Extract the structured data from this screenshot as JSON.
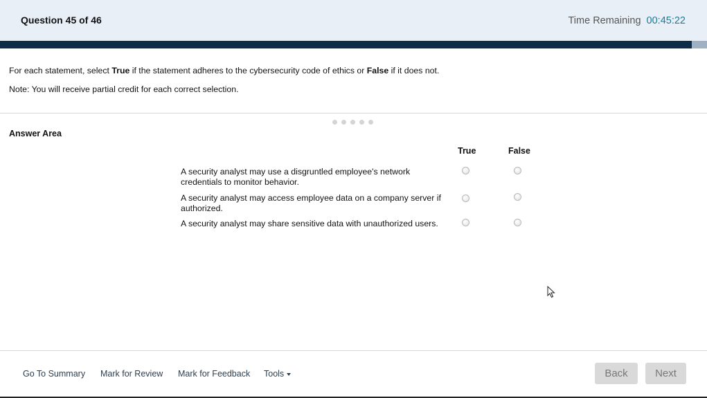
{
  "header": {
    "question_label": "Question",
    "question_number": "45 of 46",
    "time_label": "Time Remaining",
    "time_value": "00:45:22"
  },
  "progress": {
    "fraction": 0.978
  },
  "instructions": {
    "line1_part1": "For each statement, select ",
    "line1_true": "True",
    "line1_part2": " if the statement adheres to the cybersecurity code of ethics or ",
    "line1_false": "False",
    "line1_part3": " if it does not.",
    "note": "Note: You will receive partial credit for each correct selection."
  },
  "answer_area": {
    "title": "Answer Area",
    "col_true": "True",
    "col_false": "False",
    "statements": [
      {
        "text": "A security analyst may use a disgruntled employee's network credentials to monitor behavior."
      },
      {
        "text": "A security analyst may access employee data on a company server if authorized."
      },
      {
        "text": "A security analyst may share sensitive data with unauthorized users."
      }
    ]
  },
  "footer": {
    "go_to_summary": "Go To Summary",
    "mark_for_review": "Mark for Review",
    "mark_for_feedback": "Mark for Feedback",
    "tools": "Tools",
    "back": "Back",
    "next": "Next"
  },
  "colors": {
    "header_bg": "#e8eff6",
    "progress_fill": "#0e2b47",
    "timer_accent": "#1f7a93",
    "button_bg": "#d9d9d9"
  },
  "icons": [
    "pager-dots-icon",
    "mouse-cursor-icon",
    "dropdown-caret-icon"
  ]
}
